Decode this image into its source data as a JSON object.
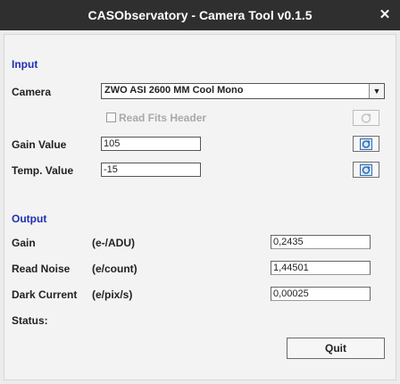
{
  "window": {
    "title": "CASObservatory - Camera Tool  v0.1.5",
    "close_glyph": "✕"
  },
  "input_section": {
    "heading": "Input",
    "camera_label": "Camera",
    "camera_selected": "ZWO ASI 2600 MM Cool Mono",
    "read_fits_label": "Read Fits Header",
    "read_fits_checked": false,
    "gain_label": "Gain Value",
    "gain_value": "105",
    "temp_label": "Temp. Value",
    "temp_value": "-15"
  },
  "output_section": {
    "heading": "Output",
    "rows": [
      {
        "label": "Gain",
        "unit": "(e-/ADU)",
        "value": "0,2435"
      },
      {
        "label": "Read Noise",
        "unit": "(e/count)",
        "value": "1,44501"
      },
      {
        "label": "Dark Current",
        "unit": "(e/pix/s)",
        "value": "0,00025"
      }
    ],
    "status_label": "Status:"
  },
  "buttons": {
    "quit_label": "Quit"
  },
  "icons": {
    "refresh": "refresh-icon",
    "combo_arrow": "chevron-down-icon",
    "close": "close-icon"
  },
  "colors": {
    "titlebar": "#2f2f2f",
    "section_heading": "#1f2eb4",
    "icon_blue": "#2f6fb3"
  }
}
